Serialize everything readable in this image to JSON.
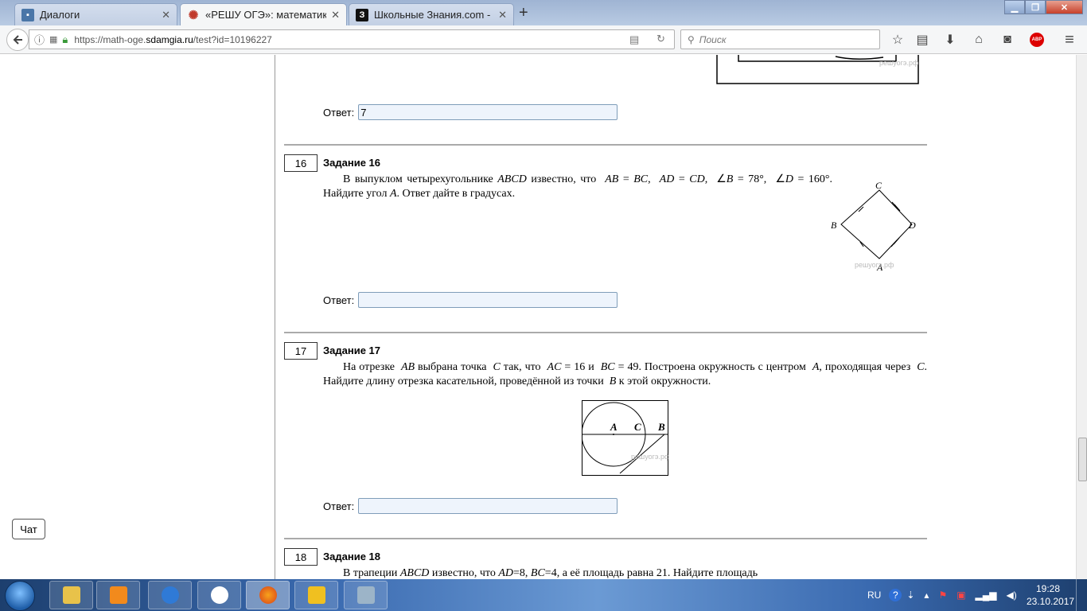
{
  "browser": {
    "tabs": [
      {
        "label": "Диалоги",
        "favicon": "vk-icon"
      },
      {
        "label": "«РЕШУ ОГЭ»: математика. О",
        "favicon": "reshu-icon"
      },
      {
        "label": "Школьные Знания.com - Ре",
        "favicon": "znania-icon"
      }
    ],
    "url_prefix": "https://math-oge.",
    "url_domain": "sdamgia.ru",
    "url_path": "/test?id=10196227",
    "search_placeholder": "Поиск",
    "adblock_label": "ABP"
  },
  "page": {
    "task15": {
      "answer_label": "Ответ:",
      "answer_value": "7",
      "watermark": "решуогэ.рф"
    },
    "task16": {
      "number": "16",
      "title": "Задание 16",
      "text_html": "В выпуклом четырехугольнике <i>ABCD</i> известно, что &nbsp;<i>AB</i> = <i>BC</i>, &nbsp;<i>AD</i> = <i>CD</i>, &nbsp;∠<i>B</i> = 78°, &nbsp;∠<i>D</i> = 160°. Найдите угол <i>A</i>. Ответ дайте в градусах.",
      "answer_label": "Ответ:",
      "answer_value": "",
      "figure_labels": {
        "A": "A",
        "B": "B",
        "C": "C",
        "D": "D"
      },
      "watermark": "решуогэ.рф"
    },
    "task17": {
      "number": "17",
      "title": "Задание 17",
      "text_html": "На отрезке &nbsp;<i>AB</i> выбрана точка &nbsp;<i>C</i> так, что &nbsp;<i>AC</i> = 16 и &nbsp;<i>BC</i> = 49. Построена окружность с центром &nbsp;<i>A</i>, проходящая через &nbsp;<i>C</i>. Найдите длину отрезка касательной, проведённой из точки &nbsp;<i>B</i> к этой окружности.",
      "answer_label": "Ответ:",
      "answer_value": "",
      "figure_labels": {
        "A": "A",
        "B": "B",
        "C": "C"
      },
      "watermark": "решуогэ.рф"
    },
    "task18": {
      "number": "18",
      "title": "Задание 18",
      "text_html": "В трапеции <i>ABCD</i> известно, что <i>AD</i>=8, <i>BC</i>=4, а её площадь равна 21. Найдите площадь"
    },
    "chat_label": "Чат"
  },
  "taskbar": {
    "language": "RU",
    "time": "19:28",
    "date": "23.10.2017"
  }
}
